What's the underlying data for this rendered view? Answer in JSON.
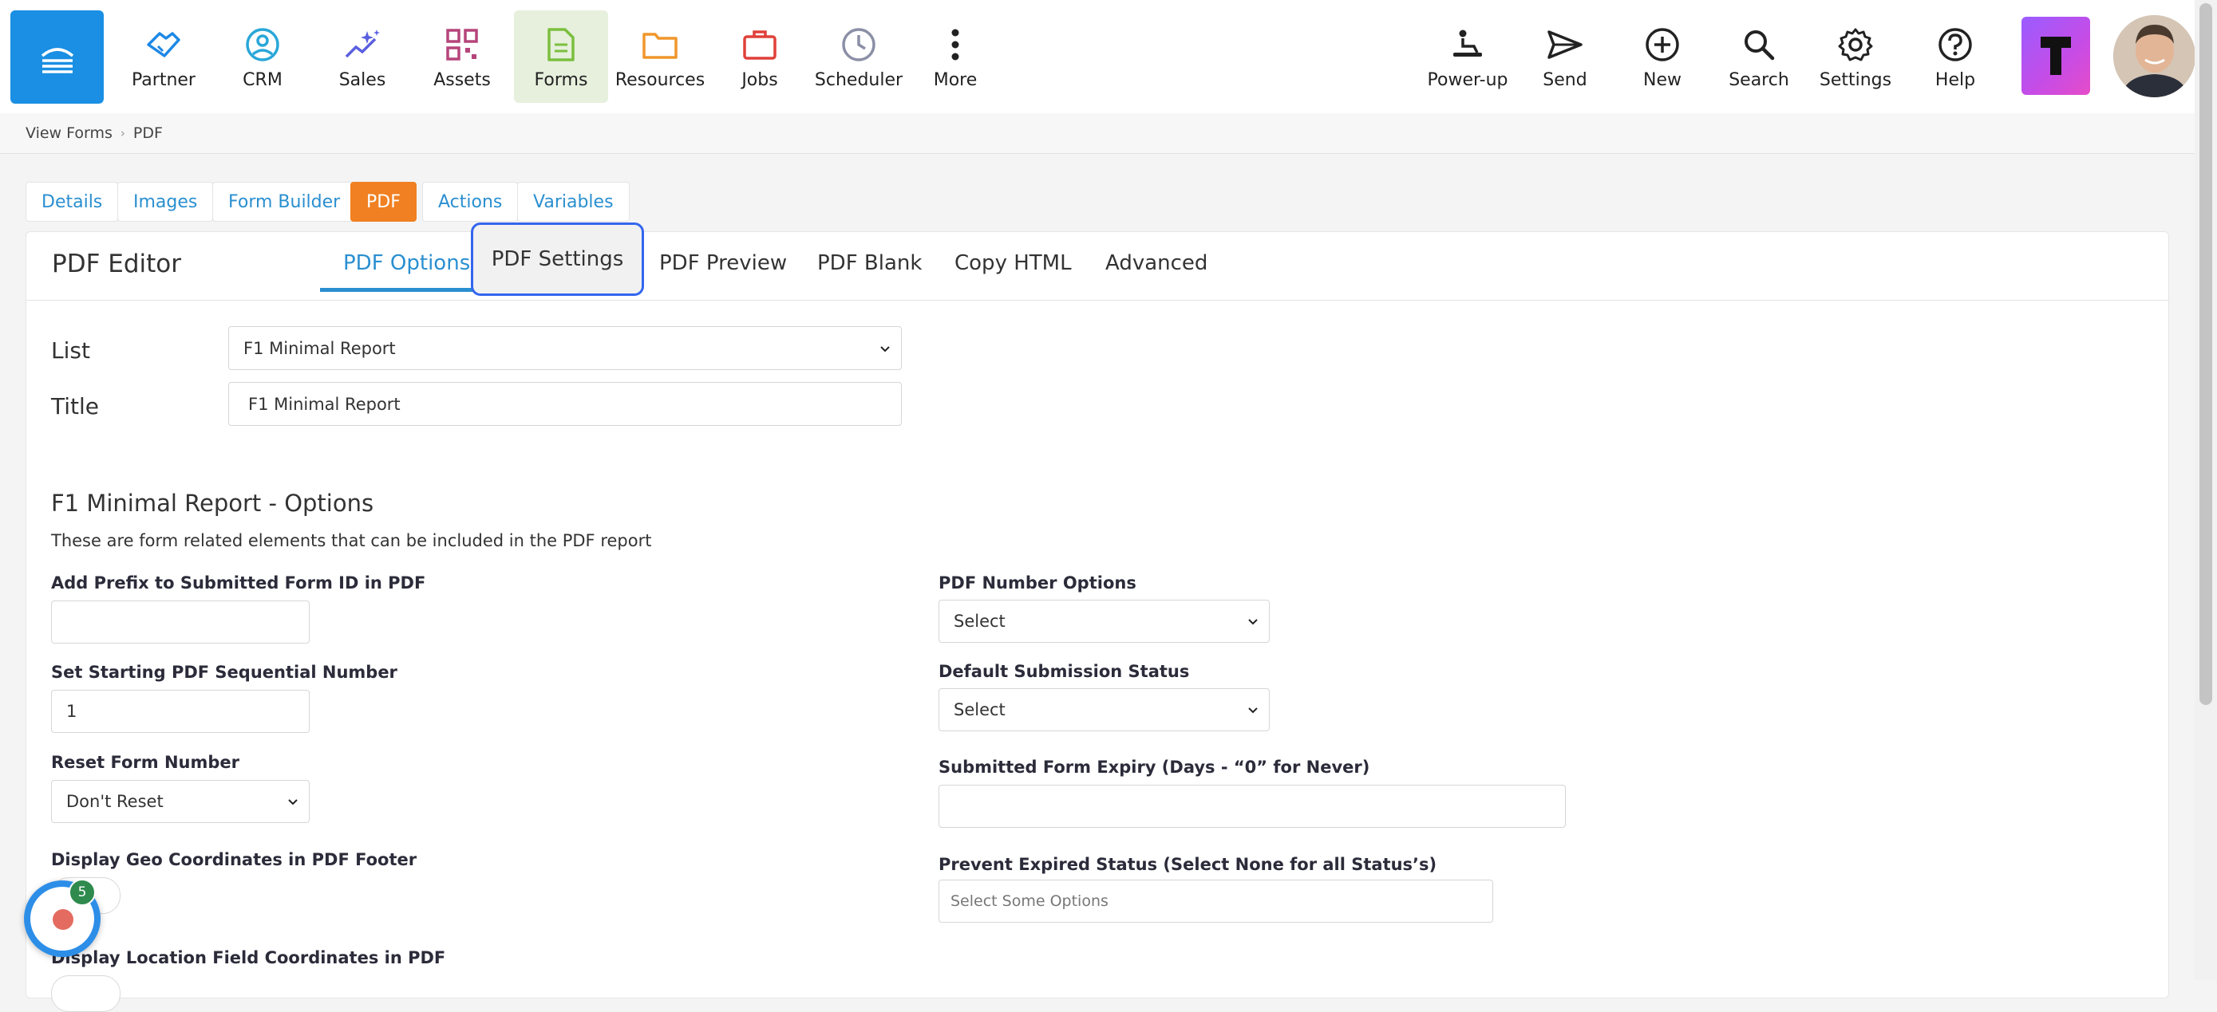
{
  "nav": {
    "items": [
      {
        "label": "Partner",
        "icon": "handshake-icon",
        "color": "#1e88e5"
      },
      {
        "label": "CRM",
        "icon": "user-circle-icon",
        "color": "#29a7d8"
      },
      {
        "label": "Sales",
        "icon": "sparkle-chart-icon",
        "color": "#5a5fe0"
      },
      {
        "label": "Assets",
        "icon": "qr-code-icon",
        "color": "#b5457a"
      },
      {
        "label": "Forms",
        "icon": "document-icon",
        "color": "#7cbf3f"
      },
      {
        "label": "Resources",
        "icon": "folder-icon",
        "color": "#f0962b"
      },
      {
        "label": "Jobs",
        "icon": "briefcase-icon",
        "color": "#e0403a"
      },
      {
        "label": "Scheduler",
        "icon": "clock-icon",
        "color": "#8b8fa6"
      },
      {
        "label": "More",
        "icon": "more-vertical-icon",
        "color": "#222222"
      }
    ],
    "right_items": [
      {
        "label": "Power-up",
        "icon": "power-up-icon"
      },
      {
        "label": "Send",
        "icon": "send-icon"
      },
      {
        "label": "New",
        "icon": "plus-circle-icon"
      },
      {
        "label": "Search",
        "icon": "search-icon"
      },
      {
        "label": "Settings",
        "icon": "gear-icon"
      },
      {
        "label": "Help",
        "icon": "help-circle-icon"
      }
    ],
    "active": "Forms"
  },
  "breadcrumb": [
    "View Forms",
    "PDF"
  ],
  "tabs": [
    "Details",
    "Images",
    "Form Builder",
    "PDF",
    "Actions",
    "Variables"
  ],
  "active_tab": "PDF",
  "editor": {
    "title": "PDF Editor",
    "sub_tabs": [
      "PDF Options",
      "PDF Settings",
      "PDF Preview",
      "PDF Blank",
      "Copy HTML",
      "Advanced"
    ],
    "active_sub_tab": "PDF Options",
    "focused_sub_tab": "PDF Settings"
  },
  "form": {
    "list_label": "List",
    "list_value": "F1 Minimal Report",
    "title_label": "Title",
    "title_value": "F1 Minimal Report"
  },
  "options": {
    "section_title": "F1 Minimal Report - Options",
    "section_desc": "These are form related elements that can be included in the PDF report",
    "prefix_label": "Add Prefix to Submitted Form ID in PDF",
    "prefix_value": "",
    "start_label": "Set Starting PDF Sequential Number",
    "start_value": "1",
    "reset_label": "Reset Form Number",
    "reset_value": "Don't Reset",
    "geo_label": "Display Geo Coordinates in PDF Footer",
    "loc_label": "Display Location Field Coordinates in PDF",
    "pdf_number_label": "PDF Number Options",
    "pdf_number_value": "Select",
    "default_status_label": "Default Submission Status",
    "default_status_value": "Select",
    "expiry_label": "Submitted Form Expiry (Days - “0” for Never)",
    "expiry_value": "",
    "prevent_label": "Prevent Expired Status (Select None for all Status’s)",
    "prevent_placeholder": "Select Some Options"
  },
  "chat": {
    "badge": "5"
  },
  "colors": {
    "accent": "#2a8fd0",
    "pdf_tab": "#f08021",
    "logo": "#1a8fe3",
    "focus": "#3366ee"
  }
}
